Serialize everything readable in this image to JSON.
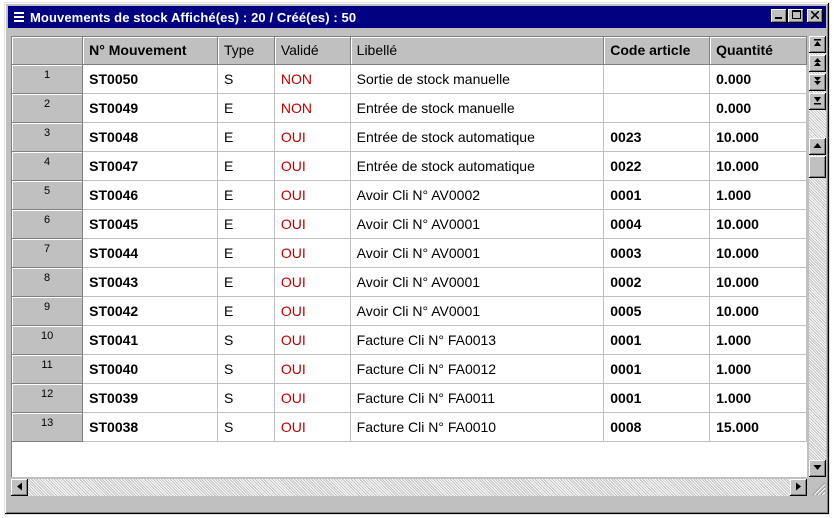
{
  "window": {
    "title": "Mouvements de stock Affiché(es) : 20 / Créé(es) : 50",
    "buttons": {
      "minimize": "_",
      "maximize": "□",
      "close": "✕"
    }
  },
  "columns": [
    "",
    "N° Mouvement",
    "Type",
    "Validé",
    "Libellé",
    "Code article",
    "Quantité"
  ],
  "rows": [
    {
      "n": "1",
      "id": "ST0050",
      "type": "S",
      "valide": "NON",
      "libelle": "Sortie de stock manuelle",
      "code": "",
      "qte": "0.000"
    },
    {
      "n": "2",
      "id": "ST0049",
      "type": "E",
      "valide": "NON",
      "libelle": "Entrée de stock manuelle",
      "code": "",
      "qte": "0.000"
    },
    {
      "n": "3",
      "id": "ST0048",
      "type": "E",
      "valide": "OUI",
      "libelle": "Entrée de stock automatique",
      "code": "0023",
      "qte": "10.000"
    },
    {
      "n": "4",
      "id": "ST0047",
      "type": "E",
      "valide": "OUI",
      "libelle": "Entrée de stock automatique",
      "code": "0022",
      "qte": "10.000"
    },
    {
      "n": "5",
      "id": "ST0046",
      "type": "E",
      "valide": "OUI",
      "libelle": "Avoir Cli N° AV0002",
      "code": "0001",
      "qte": "1.000"
    },
    {
      "n": "6",
      "id": "ST0045",
      "type": "E",
      "valide": "OUI",
      "libelle": "Avoir Cli N° AV0001",
      "code": "0004",
      "qte": "10.000"
    },
    {
      "n": "7",
      "id": "ST0044",
      "type": "E",
      "valide": "OUI",
      "libelle": "Avoir Cli N° AV0001",
      "code": "0003",
      "qte": "10.000"
    },
    {
      "n": "8",
      "id": "ST0043",
      "type": "E",
      "valide": "OUI",
      "libelle": "Avoir Cli N° AV0001",
      "code": "0002",
      "qte": "10.000"
    },
    {
      "n": "9",
      "id": "ST0042",
      "type": "E",
      "valide": "OUI",
      "libelle": "Avoir Cli N° AV0001",
      "code": "0005",
      "qte": "10.000"
    },
    {
      "n": "10",
      "id": "ST0041",
      "type": "S",
      "valide": "OUI",
      "libelle": "Facture Cli N° FA0013",
      "code": "0001",
      "qte": "1.000"
    },
    {
      "n": "11",
      "id": "ST0040",
      "type": "S",
      "valide": "OUI",
      "libelle": "Facture Cli N° FA0012",
      "code": "0001",
      "qte": "1.000"
    },
    {
      "n": "12",
      "id": "ST0039",
      "type": "S",
      "valide": "OUI",
      "libelle": "Facture Cli N° FA0011",
      "code": "0001",
      "qte": "1.000"
    },
    {
      "n": "13",
      "id": "ST0038",
      "type": "S",
      "valide": "OUI",
      "libelle": "Facture Cli N° FA0010",
      "code": "0008",
      "qte": "15.000"
    }
  ],
  "icons": {
    "window_icon": "list-icon",
    "scroll_first": "first-page-icon",
    "scroll_page_up": "page-up-icon",
    "scroll_page_down": "page-down-icon",
    "scroll_last": "last-page-icon",
    "scroll_up": "arrow-up-icon",
    "scroll_down": "arrow-down-icon",
    "scroll_left": "arrow-left-icon",
    "scroll_right": "arrow-right-icon"
  },
  "colors": {
    "titlebar": "#000080",
    "validated_text": "#c00000",
    "window_face": "#c0c0c0"
  }
}
